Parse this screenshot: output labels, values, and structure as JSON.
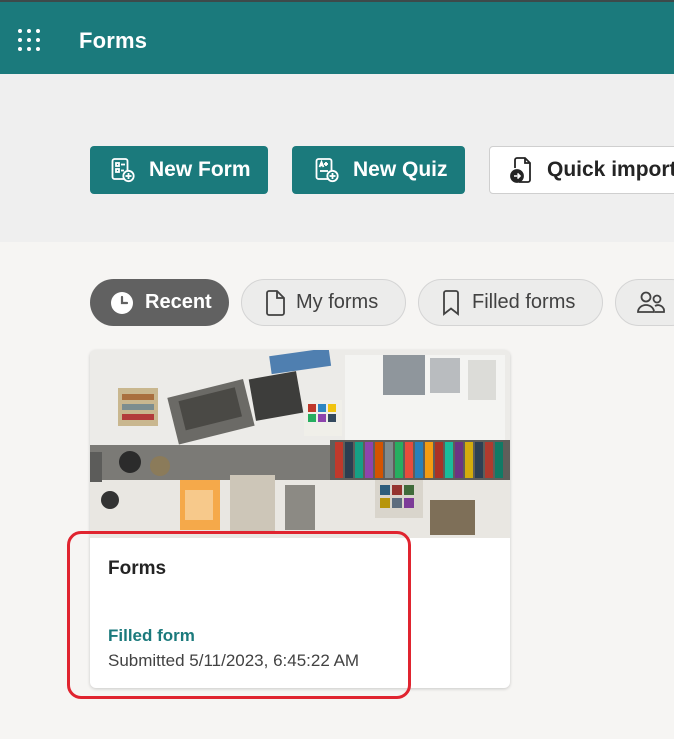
{
  "header": {
    "app_title": "Forms",
    "bg_color": "#1b7a7c"
  },
  "actions": {
    "new_form": "New Form",
    "new_quiz": "New Quiz",
    "quick_import": "Quick import"
  },
  "filters": {
    "recent": "Recent",
    "my_forms": "My forms",
    "filled_forms": "Filled forms",
    "active": "recent"
  },
  "card": {
    "title": "Forms",
    "status": "Filled form",
    "submitted": "Submitted 5/11/2023, 6:45:22 AM"
  },
  "colors": {
    "accent": "#1b7a7c",
    "highlight": "#e0242f",
    "active_pill": "#616161"
  },
  "icons": {
    "app_launcher": "waffle-icon",
    "new_form": "new-form-icon",
    "new_quiz": "new-quiz-icon",
    "quick_import": "import-file-icon",
    "recent": "clock-icon",
    "my_forms": "document-icon",
    "filled_forms": "bookmark-icon",
    "shared": "people-icon"
  }
}
